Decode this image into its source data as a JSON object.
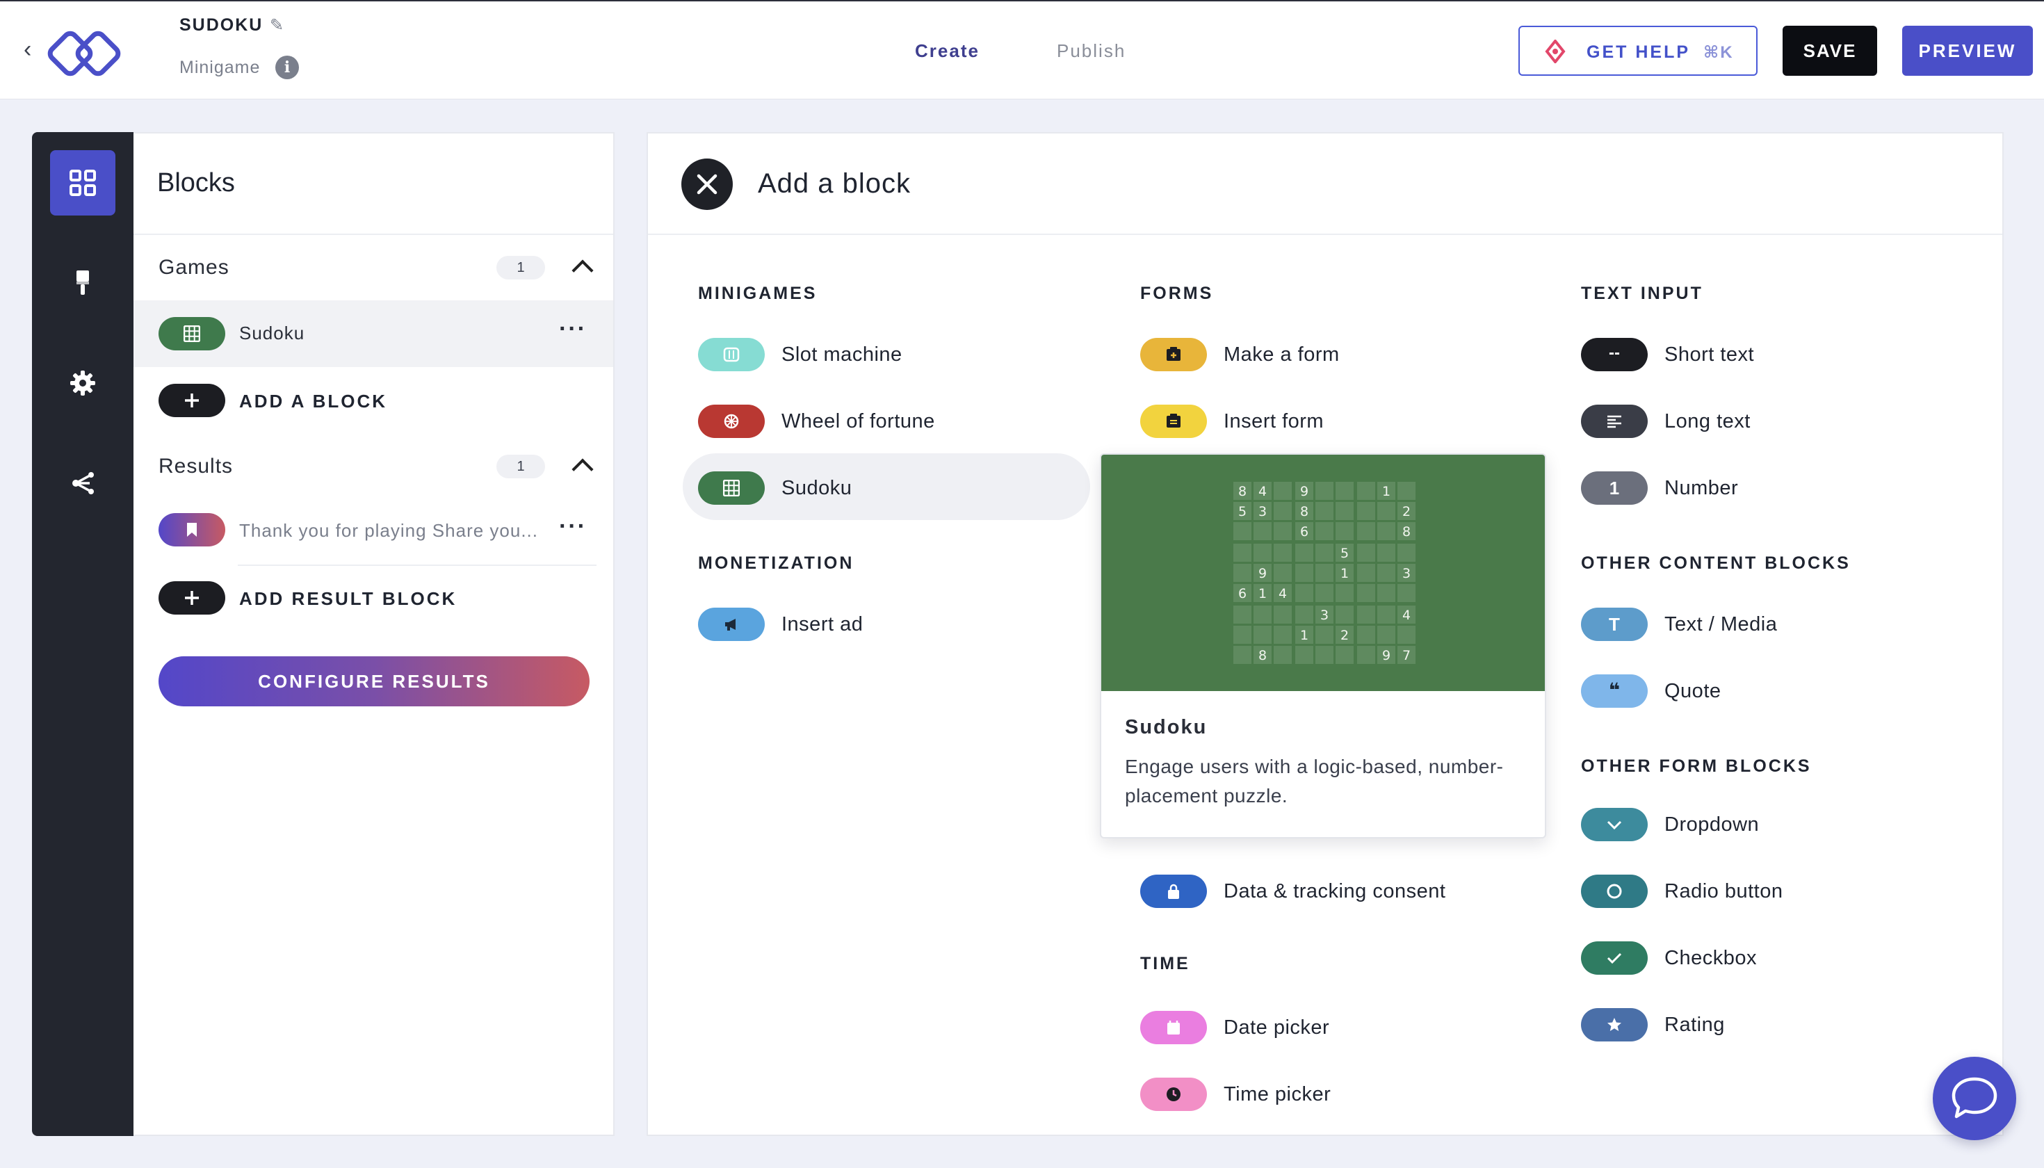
{
  "header": {
    "back_glyph": "‹",
    "project_title": "SUDOKU",
    "project_type": "Minigame",
    "info_glyph": "i",
    "tabs": [
      {
        "label": "Create",
        "active": true
      },
      {
        "label": "Publish",
        "active": false
      }
    ],
    "help_label": "GET HELP",
    "help_shortcut": "⌘K",
    "save_label": "SAVE",
    "preview_label": "PREVIEW"
  },
  "rail": {
    "items": [
      {
        "name": "blocks",
        "icon": "grid-icon",
        "active": true
      },
      {
        "name": "design",
        "icon": "paintbrush-icon",
        "active": false
      },
      {
        "name": "settings",
        "icon": "gear-icon",
        "active": false
      },
      {
        "name": "flow",
        "icon": "share-flow-icon",
        "active": false
      }
    ]
  },
  "blocks_panel": {
    "title": "Blocks",
    "games": {
      "label": "Games",
      "count": "1",
      "items": [
        {
          "label": "Sudoku",
          "icon": "grid-icon",
          "color": "#3f7a4c"
        }
      ],
      "add_label": "ADD A BLOCK"
    },
    "results": {
      "label": "Results",
      "count": "1",
      "items": [
        {
          "label": "Thank you for playing Share you...",
          "icon": "bookmark-icon"
        }
      ],
      "add_label": "ADD RESULT BLOCK"
    },
    "configure_label": "CONFIGURE RESULTS",
    "more_glyph": "···",
    "plus_glyph": "+"
  },
  "add_block": {
    "title": "Add a block",
    "categories": {
      "minigames": {
        "label": "MINIGAMES",
        "items": [
          {
            "label": "Slot machine",
            "color": "#86dcd3"
          },
          {
            "label": "Wheel of fortune",
            "color": "#b93832"
          },
          {
            "label": "Sudoku",
            "color": "#3f7a4c"
          }
        ]
      },
      "monetization": {
        "label": "MONETIZATION",
        "items": [
          {
            "label": "Insert ad",
            "color": "#5aa4de"
          }
        ]
      },
      "forms": {
        "label": "FORMS",
        "items": [
          {
            "label": "Make a form",
            "color": "#e8b53a"
          },
          {
            "label": "Insert form",
            "color": "#f2d33e"
          },
          {
            "label": "Data & tracking consent",
            "color": "#2f64c4"
          }
        ]
      },
      "time": {
        "label": "TIME",
        "items": [
          {
            "label": "Date picker",
            "color": "#ea7ee0"
          },
          {
            "label": "Time picker",
            "color": "#f28fc6"
          }
        ]
      },
      "text_input": {
        "label": "TEXT INPUT",
        "items": [
          {
            "label": "Short text",
            "color": "#1c1d22",
            "glyph": "--"
          },
          {
            "label": "Long text",
            "color": "#3a3d47"
          },
          {
            "label": "Number",
            "color": "#6b6f7c",
            "glyph": "1"
          }
        ]
      },
      "other_content": {
        "label": "OTHER CONTENT BLOCKS",
        "items": [
          {
            "label": "Text / Media",
            "color": "#5d9ccb",
            "glyph": "T"
          },
          {
            "label": "Quote",
            "color": "#7fb6ea",
            "glyph": "❝"
          }
        ]
      },
      "other_form": {
        "label": "OTHER FORM BLOCKS",
        "items": [
          {
            "label": "Dropdown",
            "color": "#3d8b9d"
          },
          {
            "label": "Radio button",
            "color": "#2f7a86"
          },
          {
            "label": "Checkbox",
            "color": "#2f7c62"
          },
          {
            "label": "Rating",
            "color": "#4a6fa8"
          }
        ]
      }
    },
    "tooltip": {
      "title": "Sudoku",
      "description": "Engage users with a logic-based, number-placement puzzle.",
      "grid_digits": [
        [
          "8",
          "4",
          "",
          "9",
          "",
          "",
          "",
          "1",
          ""
        ],
        [
          "5",
          "3",
          "",
          "8",
          "",
          "",
          "",
          "",
          "2"
        ],
        [
          "",
          "",
          "",
          "6",
          "",
          "",
          "",
          "",
          "8"
        ],
        [
          "",
          "",
          "",
          "",
          "",
          "5",
          "",
          "",
          ""
        ],
        [
          "",
          "9",
          "",
          "",
          "",
          "1",
          "",
          "",
          "3"
        ],
        [
          "6",
          "1",
          "4",
          "",
          "",
          "",
          "",
          "",
          ""
        ],
        [
          "",
          "",
          "",
          "",
          "3",
          "",
          "",
          "",
          "4"
        ],
        [
          "",
          "",
          "",
          "1",
          "",
          "2",
          "",
          "",
          ""
        ],
        [
          "",
          "8",
          "",
          "",
          "",
          "",
          "",
          "9",
          "7"
        ]
      ]
    }
  },
  "colors": {
    "accent": "#4a4fc8",
    "rail": "#23262f",
    "sudoku_green": "#4a7a4a"
  }
}
